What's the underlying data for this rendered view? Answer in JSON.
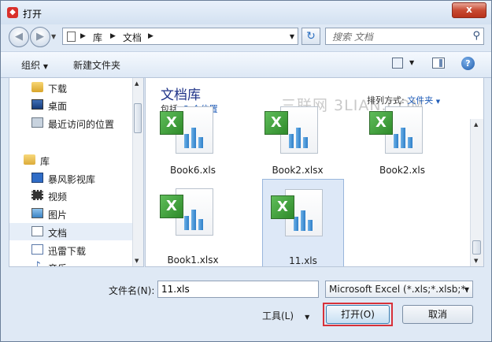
{
  "window": {
    "title": "打开",
    "close_glyph": "x"
  },
  "nav": {
    "breadcrumb": [
      "库",
      "文档"
    ],
    "search_placeholder": "搜索 文档"
  },
  "toolbar": {
    "organize": "组织",
    "new_folder": "新建文件夹",
    "help": "?"
  },
  "sidebar": {
    "items": [
      {
        "label": "下载",
        "icon": "download-folder-icon"
      },
      {
        "label": "桌面",
        "icon": "desktop-icon"
      },
      {
        "label": "最近访问的位置",
        "icon": "recent-places-icon"
      },
      {
        "label": "库",
        "icon": "library-icon"
      },
      {
        "label": "暴风影视库",
        "icon": "video-library-icon"
      },
      {
        "label": "视频",
        "icon": "video-icon"
      },
      {
        "label": "图片",
        "icon": "pictures-icon"
      },
      {
        "label": "文档",
        "icon": "documents-icon",
        "selected": true
      },
      {
        "label": "迅雷下载",
        "icon": "thunder-download-icon"
      },
      {
        "label": "音乐",
        "icon": "music-icon"
      }
    ]
  },
  "content": {
    "title": "文档库",
    "subtitle_prefix": "包括:",
    "subtitle_link": "2 个位置",
    "arrange_label": "排列方式:",
    "arrange_value": "文件夹",
    "watermark": "三联网 3LIAN.COM",
    "files": [
      {
        "name": "Book6.xls"
      },
      {
        "name": "Book2.xlsx"
      },
      {
        "name": "Book2.xls"
      },
      {
        "name": "Book1.xlsx"
      },
      {
        "name": "11.xls",
        "selected": true
      }
    ]
  },
  "bottom": {
    "filename_label": "文件名(N):",
    "filename_value": "11.xls",
    "filter_value": "Microsoft Excel (*.xls;*.xlsb;*.",
    "tools_label": "工具(L)",
    "open_label": "打开(O)",
    "cancel_label": "取消"
  }
}
